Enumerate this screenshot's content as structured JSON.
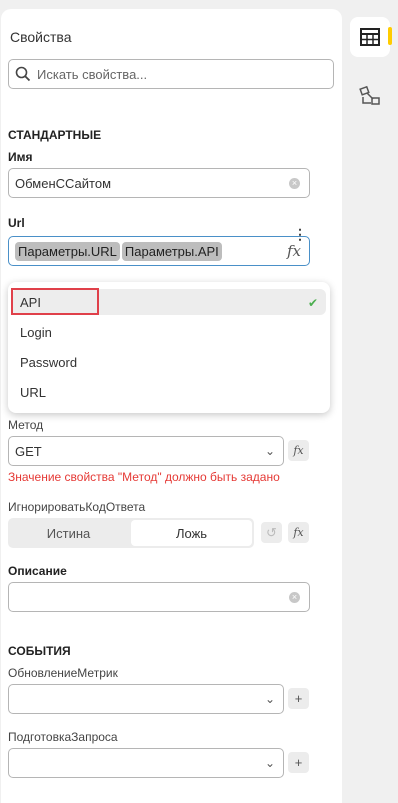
{
  "panel": {
    "title": "Свойства",
    "search": {
      "placeholder": "Искать свойства..."
    }
  },
  "standard": {
    "section_label": "СТАНДАРТНЫЕ",
    "name": {
      "label": "Имя",
      "value": "ОбменССайтом"
    },
    "url": {
      "label": "Url",
      "chips": [
        "Параметры.URL",
        "Параметры.API"
      ],
      "fx_label": "fx",
      "options": [
        {
          "label": "API",
          "selected": true
        },
        {
          "label": "Login",
          "selected": false
        },
        {
          "label": "Password",
          "selected": false
        },
        {
          "label": "URL",
          "selected": false
        }
      ]
    },
    "method": {
      "label": "Метод",
      "value": "GET",
      "error": "Значение свойства \"Метод\" должно быть задано"
    },
    "ignore_code": {
      "label": "ИгнорироватьКодОтвета",
      "options": [
        "Истина",
        "Ложь"
      ],
      "selected": "Ложь"
    },
    "description": {
      "label": "Описание",
      "value": ""
    }
  },
  "events": {
    "section_label": "СОБЫТИЯ",
    "metrics_update": {
      "label": "ОбновлениеМетрик",
      "value": ""
    },
    "request_prep": {
      "label": "ПодготовкаЗапроса",
      "value": ""
    }
  },
  "icons": {
    "search": "search-icon",
    "clear": "clear-icon",
    "chevron": "chevron-down-icon",
    "check": "check-icon",
    "more": "more-vertical-icon",
    "undo": "undo-icon",
    "add": "plus-icon",
    "table": "table-icon",
    "flow": "flow-icon"
  },
  "colors": {
    "accent": "#ffcc00",
    "error": "#e53935",
    "check": "#4caf50",
    "highlight": "#e0404a"
  }
}
